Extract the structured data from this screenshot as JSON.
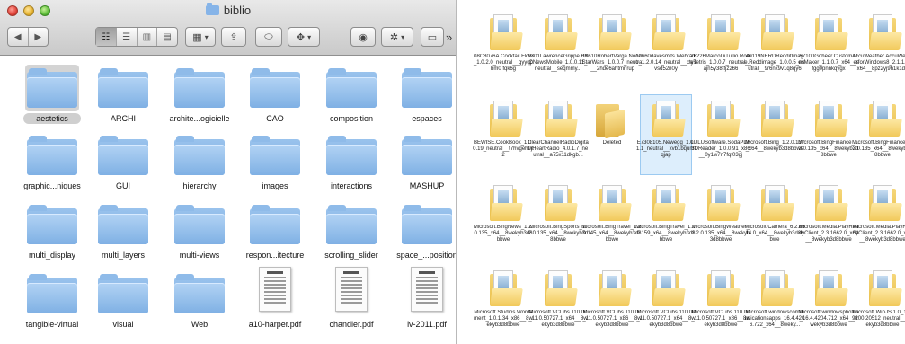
{
  "finder": {
    "title": "biblio",
    "toolbar": {
      "back": "◀",
      "forward": "▶",
      "view_icon": "☷",
      "view_list": "☰",
      "view_column": "▥",
      "view_cover": "▤",
      "arrange": "▦",
      "share": "⇪",
      "tag": "⬭",
      "dropbox": "✥",
      "quicklook": "◉",
      "action": "✲",
      "path": "▭",
      "more": "»"
    },
    "items": [
      {
        "name": "aestetics",
        "kind": "folder",
        "selected": true
      },
      {
        "name": "ARCHI",
        "kind": "folder"
      },
      {
        "name": "archite...ogicielle",
        "kind": "folder"
      },
      {
        "name": "CAO",
        "kind": "folder"
      },
      {
        "name": "composition",
        "kind": "folder"
      },
      {
        "name": "espaces",
        "kind": "folder"
      },
      {
        "name": "graphic...niques",
        "kind": "folder"
      },
      {
        "name": "GUI",
        "kind": "folder"
      },
      {
        "name": "hierarchy",
        "kind": "folder"
      },
      {
        "name": "images",
        "kind": "folder"
      },
      {
        "name": "interactions",
        "kind": "folder"
      },
      {
        "name": "MASHUP",
        "kind": "folder"
      },
      {
        "name": "multi_display",
        "kind": "folder"
      },
      {
        "name": "multi_layers",
        "kind": "folder"
      },
      {
        "name": "multi-views",
        "kind": "folder"
      },
      {
        "name": "respon...itecture",
        "kind": "folder"
      },
      {
        "name": "scrolling_slider",
        "kind": "folder"
      },
      {
        "name": "space_...position",
        "kind": "folder"
      },
      {
        "name": "tangible-virtual",
        "kind": "folder"
      },
      {
        "name": "visual",
        "kind": "folder"
      },
      {
        "name": "Web",
        "kind": "folder"
      },
      {
        "name": "a10-harper.pdf",
        "kind": "pdf"
      },
      {
        "name": "chandler.pdf",
        "kind": "pdf"
      },
      {
        "name": "iv-2011.pdf",
        "kind": "pdf"
      }
    ]
  },
  "explorer": {
    "items": [
      {
        "name": "08C8076A.Cocktail Flow_1.0.2.0_neutral__gyyqpbm0 fqk6g"
      },
      {
        "name": "9301LawrenceGrippe.BBCNewsMobile_1.0.0.11_neutral__seqmmy..."
      },
      {
        "name": "11610RobertVarga.NoooStarWars_1.0.0.7_neutral__2hde6ahtmnrup"
      },
      {
        "name": "12660davesmits.Webradio_1.2.0.14_neutral__xtysvsd52n0y"
      },
      {
        "name": "26226MarcoDiTullio.RomeTetris_1.0.0.7_neutral__ajn5y38tfjz266"
      },
      {
        "name": "40119NERDRedditImage.Reddimage_1.0.0.5_neutral__9r6nk9v1q8qy6"
      },
      {
        "name": "57100Goheer.CustomTilesMaker_1.1.0.7_x64__sfgg0pnnkqygx"
      },
      {
        "name": "AccuWeather.AccuWeatherforWindows8_2.1.1.1_x64__8pz2yj9h1k1d8"
      },
      {
        "name": "BEWISE.CookBook_1.0.0.19_neutral__t7hvgeh9jt2"
      },
      {
        "name": "ClearChannelRadioDigital.iHeartRadio_4.0.1.7_neutral__a75x11dkgb..."
      },
      {
        "name": "Deleted",
        "kind": "open"
      },
      {
        "name": "E7308105.Newegg_1.0.1.1_neutral__xvb1bqumfqjap",
        "selected": true
      },
      {
        "name": "LULUSoftware.SodaPDF3DReader_1.0.0.91_x86__0y1w7n7fqf03gj"
      },
      {
        "name": "Microsoft.Bing_1.2.0.137_x64__8wekyb3d8bbwe"
      },
      {
        "name": "Microsoft.BingFinance_1.2.0.135_x64__8wekyb3d8bbwe"
      },
      {
        "name": "Microsoft.BingFinance_1.2.0.135_x64__8wekyb3d8bbwe"
      },
      {
        "name": "Microsoft.BingNews_1.2.0.135_x64__8wekyb3d8bbwe"
      },
      {
        "name": "Microsoft.BingSports_1.2.0.135_x64__8wekyb3d8bbwe"
      },
      {
        "name": "Microsoft.BingTravel_1.2.0.145_x64__8wekyb3d8bbwe"
      },
      {
        "name": "Microsoft.BingTravel_1.2.0.159_x64__8wekyb3d8bbwe"
      },
      {
        "name": "Microsoft.BingWeather_1.2.0.135_x64__8wekyb3d8bbwe"
      },
      {
        "name": "Microsoft.Camera_6.2.8514.0_x64__8wekyb3d8bbwe"
      },
      {
        "name": "Microsoft.Media.PlayReadyClient_2.3.1662.0_x64__8wekyb3d8bbwe"
      },
      {
        "name": "Microsoft.Media.PlayReadyClient_2.3.1662.0_x86__8wekyb3d8bbwe"
      },
      {
        "name": "Microsoft.Studios.Wordament_1.0.1.34_x86__8wekyb3d8bbwe"
      },
      {
        "name": "Microsoft.VCLibs.110.00_11.0.50727.1_x64__8wekyb3d8bbwe"
      },
      {
        "name": "Microsoft.VCLibs.110.00_11.0.50727.1_x86__8wekyb3d8bbwe"
      },
      {
        "name": "Microsoft.VCLibs.110.00_11.0.50727.1_x64__8wekyb3d8bbwe"
      },
      {
        "name": "Microsoft.VCLibs.110.00_11.0.50727.1_x86__8wekyb3d8bbwe"
      },
      {
        "name": "Microsoft.windowscommunicationsapps_16.4.4206.722_x64__8weky..."
      },
      {
        "name": "Microsoft.windowsphotos_16.4.4204.712_x64__8wekyb3d8bbwe"
      },
      {
        "name": "Microsoft.WinJS.1.0_1.0.9200.20512_neutral__8wekyb3d8bbwe"
      }
    ]
  }
}
